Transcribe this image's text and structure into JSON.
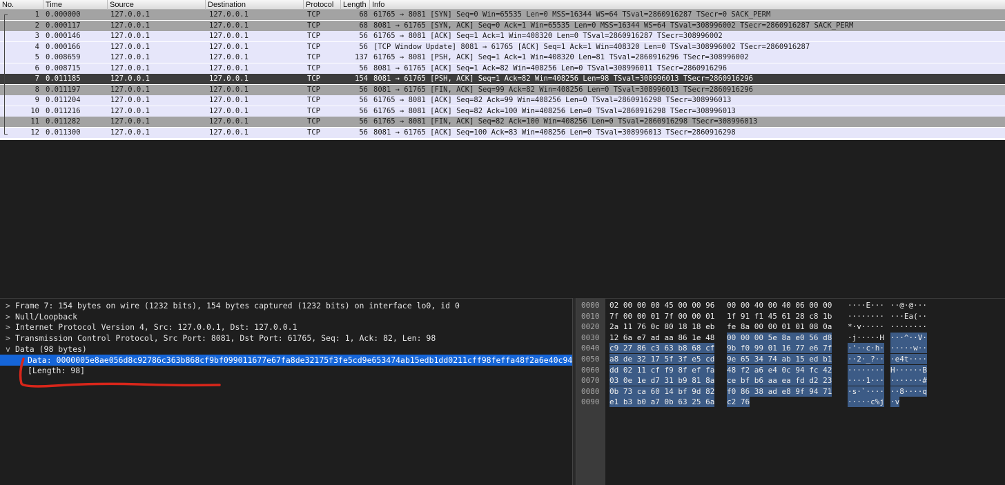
{
  "columns": [
    "No.",
    "Time",
    "Source",
    "Destination",
    "Protocol",
    "Length",
    "Info"
  ],
  "packets": [
    {
      "no": "1",
      "time": "0.000000",
      "src": "127.0.0.1",
      "dst": "127.0.0.1",
      "proto": "TCP",
      "len": "68",
      "info": "61765 → 8081 [SYN] Seq=0 Win=65535 Len=0 MSS=16344 WS=64 TSval=2860916287 TSecr=0 SACK_PERM",
      "style": "grey"
    },
    {
      "no": "2",
      "time": "0.000117",
      "src": "127.0.0.1",
      "dst": "127.0.0.1",
      "proto": "TCP",
      "len": "68",
      "info": "8081 → 61765 [SYN, ACK] Seq=0 Ack=1 Win=65535 Len=0 MSS=16344 WS=64 TSval=308996002 TSecr=2860916287 SACK_PERM",
      "style": "grey"
    },
    {
      "no": "3",
      "time": "0.000146",
      "src": "127.0.0.1",
      "dst": "127.0.0.1",
      "proto": "TCP",
      "len": "56",
      "info": "61765 → 8081 [ACK] Seq=1 Ack=1 Win=408320 Len=0 TSval=2860916287 TSecr=308996002",
      "style": "lav"
    },
    {
      "no": "4",
      "time": "0.000166",
      "src": "127.0.0.1",
      "dst": "127.0.0.1",
      "proto": "TCP",
      "len": "56",
      "info": "[TCP Window Update] 8081 → 61765 [ACK] Seq=1 Ack=1 Win=408320 Len=0 TSval=308996002 TSecr=2860916287",
      "style": "lav"
    },
    {
      "no": "5",
      "time": "0.008659",
      "src": "127.0.0.1",
      "dst": "127.0.0.1",
      "proto": "TCP",
      "len": "137",
      "info": "61765 → 8081 [PSH, ACK] Seq=1 Ack=1 Win=408320 Len=81 TSval=2860916296 TSecr=308996002",
      "style": "lav"
    },
    {
      "no": "6",
      "time": "0.008715",
      "src": "127.0.0.1",
      "dst": "127.0.0.1",
      "proto": "TCP",
      "len": "56",
      "info": "8081 → 61765 [ACK] Seq=1 Ack=82 Win=408256 Len=0 TSval=308996011 TSecr=2860916296",
      "style": "lav"
    },
    {
      "no": "7",
      "time": "0.011185",
      "src": "127.0.0.1",
      "dst": "127.0.0.1",
      "proto": "TCP",
      "len": "154",
      "info": "8081 → 61765 [PSH, ACK] Seq=1 Ack=82 Win=408256 Len=98 TSval=308996013 TSecr=2860916296",
      "style": "sel"
    },
    {
      "no": "8",
      "time": "0.011197",
      "src": "127.0.0.1",
      "dst": "127.0.0.1",
      "proto": "TCP",
      "len": "56",
      "info": "8081 → 61765 [FIN, ACK] Seq=99 Ack=82 Win=408256 Len=0 TSval=308996013 TSecr=2860916296",
      "style": "grey"
    },
    {
      "no": "9",
      "time": "0.011204",
      "src": "127.0.0.1",
      "dst": "127.0.0.1",
      "proto": "TCP",
      "len": "56",
      "info": "61765 → 8081 [ACK] Seq=82 Ack=99 Win=408256 Len=0 TSval=2860916298 TSecr=308996013",
      "style": "lav"
    },
    {
      "no": "10",
      "time": "0.011216",
      "src": "127.0.0.1",
      "dst": "127.0.0.1",
      "proto": "TCP",
      "len": "56",
      "info": "61765 → 8081 [ACK] Seq=82 Ack=100 Win=408256 Len=0 TSval=2860916298 TSecr=308996013",
      "style": "lav"
    },
    {
      "no": "11",
      "time": "0.011282",
      "src": "127.0.0.1",
      "dst": "127.0.0.1",
      "proto": "TCP",
      "len": "56",
      "info": "61765 → 8081 [FIN, ACK] Seq=82 Ack=100 Win=408256 Len=0 TSval=2860916298 TSecr=308996013",
      "style": "grey"
    },
    {
      "no": "12",
      "time": "0.011300",
      "src": "127.0.0.1",
      "dst": "127.0.0.1",
      "proto": "TCP",
      "len": "56",
      "info": "8081 → 61765 [ACK] Seq=100 Ack=83 Win=408256 Len=0 TSval=308996013 TSecr=2860916298",
      "style": "lav"
    }
  ],
  "details": [
    {
      "arrow": ">",
      "text": "Frame 7: 154 bytes on wire (1232 bits), 154 bytes captured (1232 bits) on interface lo0, id 0"
    },
    {
      "arrow": ">",
      "text": "Null/Loopback"
    },
    {
      "arrow": ">",
      "text": "Internet Protocol Version 4, Src: 127.0.0.1, Dst: 127.0.0.1"
    },
    {
      "arrow": ">",
      "text": "Transmission Control Protocol, Src Port: 8081, Dst Port: 61765, Seq: 1, Ack: 82, Len: 98"
    },
    {
      "arrow": "v",
      "text": "Data (98 bytes)"
    },
    {
      "arrow": "",
      "text": "Data: 0000005e8ae056d8c92786c363b868cf9bf099011677e67fa8de32175f3fe5cd9e653474ab15edb1dd0211cff98feffa48f2a6e40c94…",
      "child": true,
      "highlight": true
    },
    {
      "arrow": "",
      "text": "[Length: 98]",
      "child": true
    }
  ],
  "hex_rows": [
    {
      "off": "0000",
      "a": "02 00 00 00 45 00 00 96",
      "b": "00 00 40 00 40 06 00 00",
      "asc1": "····E···",
      "asc2": "··@·@···"
    },
    {
      "off": "0010",
      "a": "7f 00 00 01 7f 00 00 01",
      "b": "1f 91 f1 45 61 28 c8 1b",
      "asc1": "········",
      "asc2": "···Ea(··"
    },
    {
      "off": "0020",
      "a": "2a 11 76 0c 80 18 18 eb",
      "b": "fe 8a 00 00 01 01 08 0a",
      "asc1": "*·v·····",
      "asc2": "········"
    },
    {
      "off": "0030",
      "a": "12 6a e7 ad aa 86 1e 48",
      "b": "00 00 00 5e 8a e0 56 d8",
      "asc1": "·j·····H",
      "asc2": "···^··V·"
    },
    {
      "off": "0040",
      "a": "c9 27 86 c3 63 b8 68 cf",
      "b": "9b f0 99 01 16 77 e6 7f",
      "asc1": "·'··c·h·",
      "asc2": "·····w··"
    },
    {
      "off": "0050",
      "a": "a8 de 32 17 5f 3f e5 cd",
      "b": "9e 65 34 74 ab 15 ed b1",
      "asc1": "··2·_?··",
      "asc2": "·e4t····"
    },
    {
      "off": "0060",
      "a": "dd 02 11 cf f9 8f ef fa",
      "b": "48 f2 a6 e4 0c 94 fc 42",
      "asc1": "········",
      "asc2": "H······B"
    },
    {
      "off": "0070",
      "a": "03 0e 1e d7 31 b9 81 8a",
      "b": "ce bf b6 aa ea fd d2 23",
      "asc1": "····1···",
      "asc2": "·······#"
    },
    {
      "off": "0080",
      "a": "0b 73 ca 60 14 bf 9d 82",
      "b": "f0 86 38 ad e8 9f 94 71",
      "asc1": "·s·`····",
      "asc2": "··8····q"
    },
    {
      "off": "0090",
      "a": "e1 b3 b0 a7 0b 63 25 6a",
      "b": "c2 76",
      "asc1": "·····c%j",
      "asc2": "·v"
    }
  ]
}
